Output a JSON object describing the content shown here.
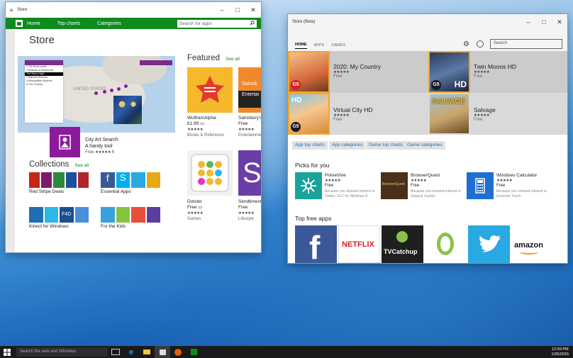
{
  "taskbar": {
    "search_placeholder": "Search the web and Windows",
    "time": "12:59 PM",
    "date": "1/25/2015"
  },
  "window_store": {
    "title": "Store",
    "nav": [
      "Home",
      "Top charts",
      "Categories"
    ],
    "search_placeholder": "Search for apps",
    "page_title": "Store",
    "map_watermark": "UNITED STATES",
    "map_list": [
      "1  The Rock Lands",
      "2  Museum of Modern Art",
      "The Starry Night",
      "3  National Museum",
      "4  Metropolitan Museum",
      "In The Country"
    ],
    "featured_hero": {
      "name": "City Art Search",
      "tagline": "A handy tool",
      "price": "Free",
      "rating_count": "6"
    },
    "featured": {
      "title": "Featured",
      "see_all": "See all",
      "items": [
        {
          "name": "WolframAlpha",
          "price": "£1.99",
          "category": "Books & Reference",
          "color": "#f6b92b"
        },
        {
          "name": "Sainsbury's TV",
          "price": "Free",
          "category": "Entertainment",
          "logo_text": "Sainsb",
          "logo_sub": "Entertai",
          "color": "#f0892c"
        },
        {
          "name": "Dotster",
          "price": "Free",
          "category": "Games",
          "color": "#f2f2f2"
        },
        {
          "name": "Sendtiment",
          "price": "Free",
          "category": "Lifestyle",
          "color": "#6b3da6"
        }
      ]
    },
    "collections": {
      "title": "Collections",
      "see_all": "See all",
      "items": [
        {
          "name": "Red Stripe Deals"
        },
        {
          "name": "Essential Apps"
        },
        {
          "name": "Kinect for Windows",
          "tile_text": "F4D"
        },
        {
          "name": "For the Kids"
        }
      ]
    }
  },
  "window_beta": {
    "title": "Store (Beta)",
    "tabs": [
      "HOME",
      "APPS",
      "GAMES"
    ],
    "search_placeholder": "Search",
    "hero_games": [
      {
        "name": "2020: My Country",
        "price": "Free",
        "badge": "G5"
      },
      {
        "name": "Twin Moons HD",
        "price": "Free",
        "badge": "G5",
        "tile_text": "HD"
      },
      {
        "name": "Virtual City HD",
        "price": "Free",
        "badge": "G5",
        "tile_text": "HD"
      },
      {
        "name": "Salvage",
        "price": "Free",
        "tile_text": "SALVAGE"
      }
    ],
    "pills": [
      "App top charts",
      "App categories",
      "Game top charts",
      "Game categories"
    ],
    "picks": {
      "title": "Picks for you",
      "items": [
        {
          "name": "PrimeVine",
          "price": "Free",
          "reason1": "Because you showed interest in",
          "reason2": "Twitter, VLC for Windows 8",
          "color": "#1aa39a"
        },
        {
          "name": "BrowserQuest",
          "price": "Free",
          "reason1": "Because you showed interest in",
          "reason2": "Jetpack Joyride",
          "tile_text": "BrowserQuest",
          "color": "#4a2f1b"
        },
        {
          "name": "Windows Calculator",
          "price": "Free",
          "reason1": "Because you showed interest in",
          "reason2": "Evernote Touch",
          "color": "#1f6fd1"
        }
      ]
    },
    "top_free": {
      "title": "Top free apps",
      "items": [
        {
          "name": "Facebook",
          "tile_text": "f",
          "color": "#3b5998"
        },
        {
          "name": "Netflix",
          "tile_text": "NETFLIX",
          "color": "#ffffff"
        },
        {
          "name": "TVCatchup",
          "tile_text": "TVCatchup",
          "color": "#1f1f1f"
        },
        {
          "name": "Oyster",
          "tile_text": "O",
          "color": "#ffffff"
        },
        {
          "name": "Twitter",
          "color": "#29a9e1"
        },
        {
          "name": "Amazon",
          "tile_text": "amazon",
          "color": "#ffffff"
        }
      ]
    }
  }
}
